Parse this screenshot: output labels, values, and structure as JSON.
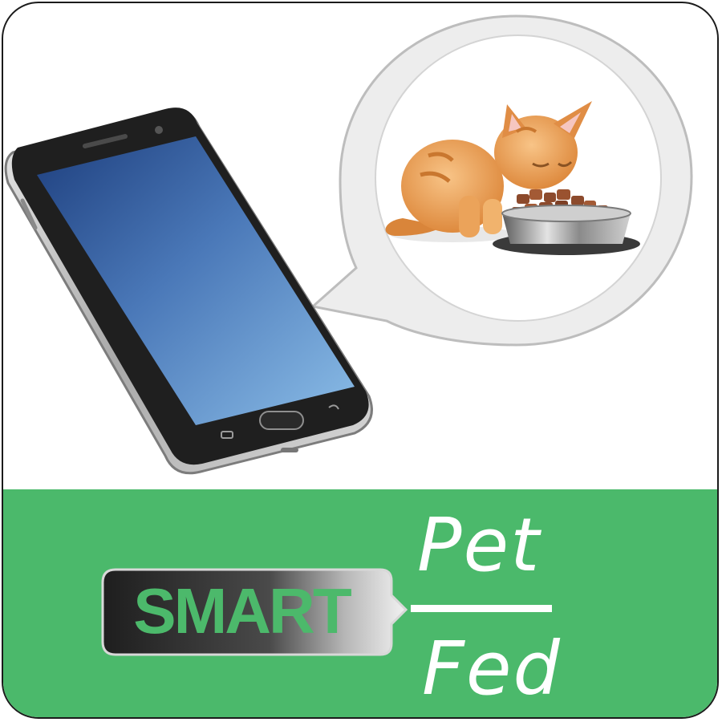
{
  "brand": {
    "badge_text": "SMART",
    "word_top": "Pet",
    "word_bottom": "Fed"
  },
  "icons": {
    "phone": "smartphone-icon",
    "bubble": "speech-bubble-icon",
    "kitten": "kitten-eating-icon",
    "bowl": "food-bowl-icon"
  },
  "colors": {
    "band_green": "#4bb96b",
    "phone_screen": "#4a78b8",
    "badge_dark": "#2a2a2a",
    "border": "#1b1b1b",
    "text_white": "#ffffff"
  }
}
